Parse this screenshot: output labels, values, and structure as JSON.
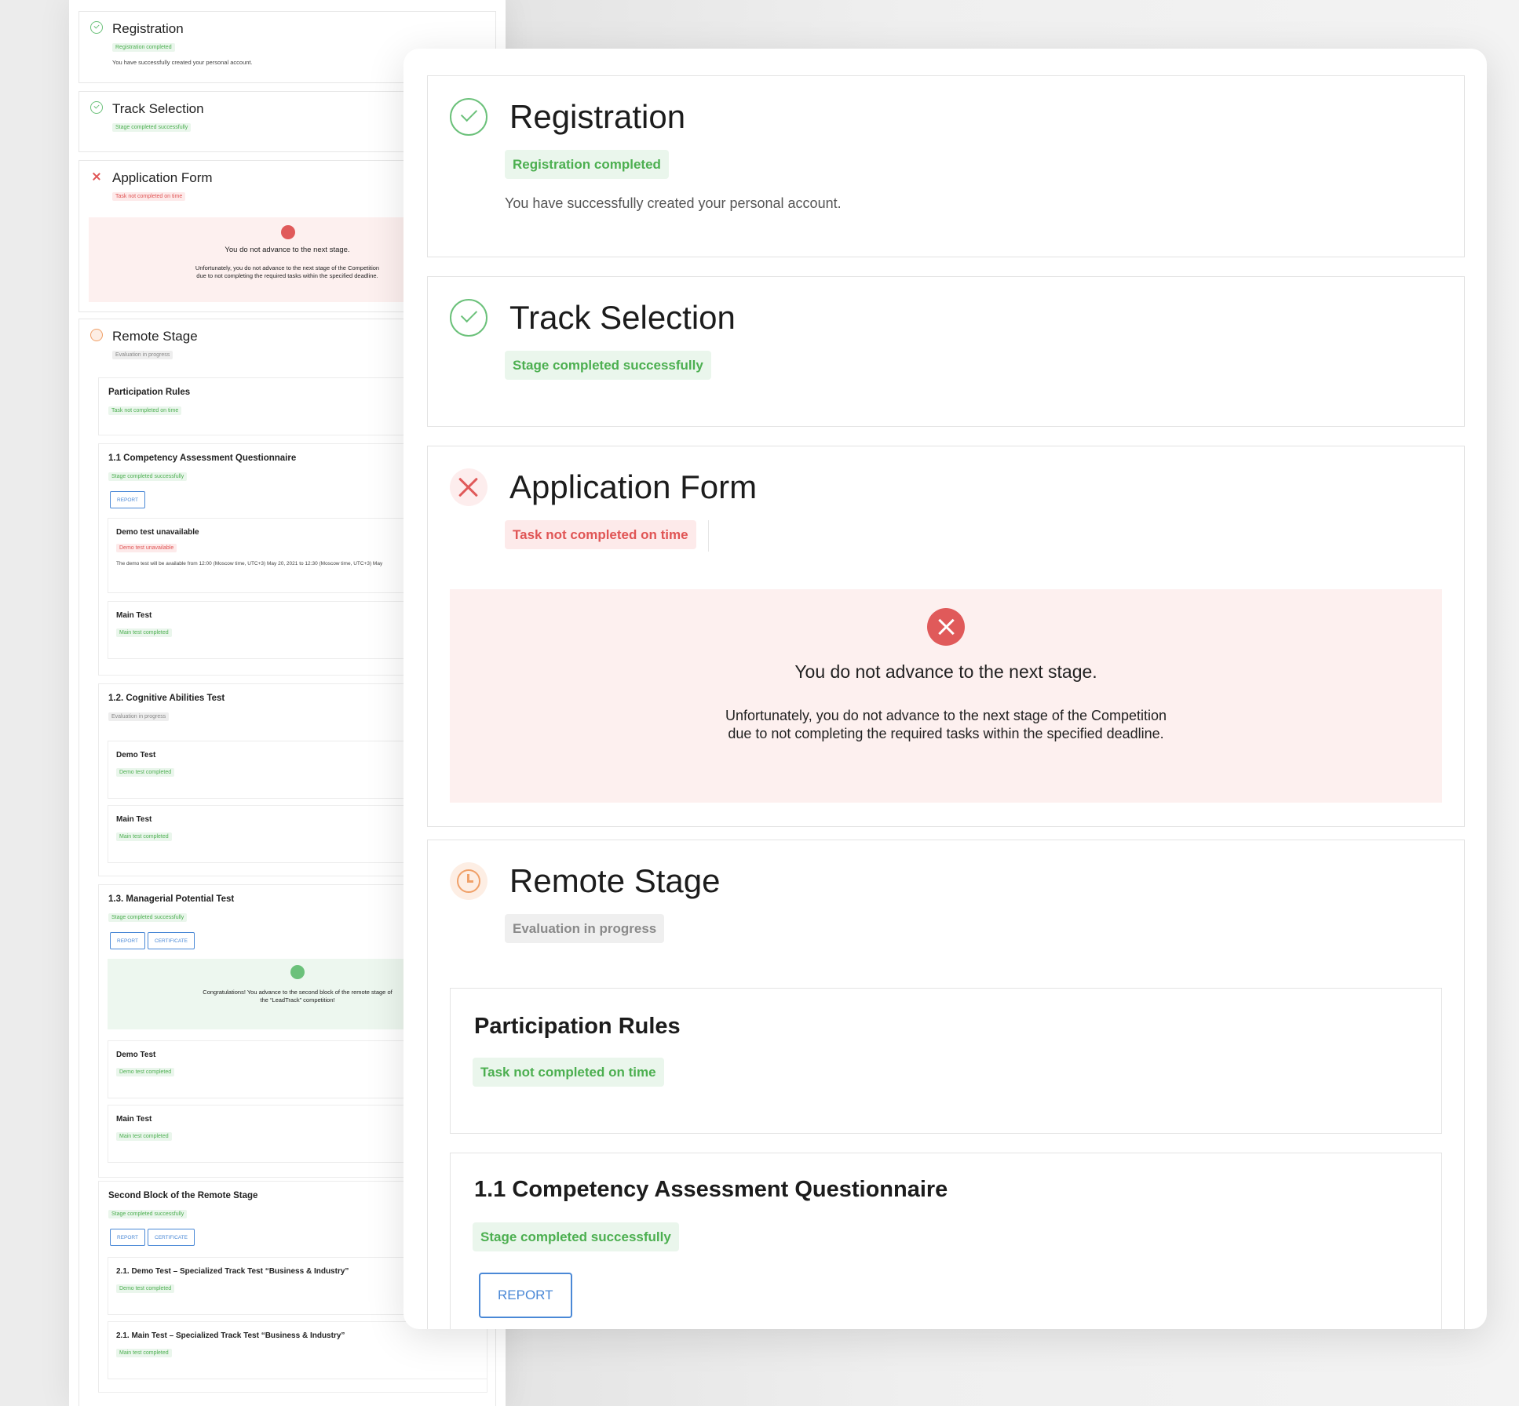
{
  "stages": {
    "registration": {
      "title": "Registration",
      "status": "Registration completed",
      "description": "You have successfully created your personal account."
    },
    "track_selection": {
      "title": "Track Selection",
      "status": "Stage completed successfully"
    },
    "application_form": {
      "title": "Application Form",
      "status": "Task not completed on time",
      "alert_title": "You do not advance to the next stage.",
      "alert_line1": "Unfortunately, you do not advance to the next stage of the Competition",
      "alert_line2": "due to not completing the required tasks within the specified deadline."
    },
    "remote_stage": {
      "title": "Remote Stage",
      "status": "Evaluation in progress",
      "participation_rules": {
        "title": "Participation Rules",
        "status": "Task not completed on time"
      },
      "competency": {
        "title": "1.1 Competency Assessment Questionnaire",
        "status": "Stage completed successfully",
        "report_label": "REPORT"
      }
    }
  },
  "mini": {
    "registration": {
      "title": "Registration",
      "status": "Registration completed",
      "description": "You have successfully created your personal account."
    },
    "track_selection": {
      "title": "Track Selection",
      "status": "Stage completed successfully"
    },
    "application_form": {
      "title": "Application Form",
      "status": "Task not completed on time",
      "alert_title": "You do not advance to the next stage.",
      "alert_line1": "Unfortunately, you do not advance to the next stage of the Competition",
      "alert_line2": "due to not completing the required tasks within the specified deadline."
    },
    "remote_stage": {
      "title": "Remote Stage",
      "status": "Evaluation in progress"
    },
    "participation_rules": {
      "title": "Participation Rules",
      "status": "Task not completed on time"
    },
    "competency": {
      "title": "1.1 Competency Assessment Questionnaire",
      "status": "Stage completed successfully",
      "report": "REPORT"
    },
    "demo_unavailable": {
      "title": "Demo test unavailable",
      "status": "Demo test unavailable",
      "description": "The demo test will be available from 12:00 (Moscow time, UTC+3) May 20, 2021 to 12:30 (Moscow time, UTC+3) May"
    },
    "main_test_1": {
      "title": "Main Test",
      "status": "Main test completed"
    },
    "cognitive": {
      "title": "1.2. Cognitive Abilities Test",
      "status": "Evaluation in progress"
    },
    "demo_test_2": {
      "title": "Demo Test",
      "status": "Demo test completed"
    },
    "main_test_2": {
      "title": "Main Test",
      "status": "Main test completed"
    },
    "managerial": {
      "title": "1.3. Managerial Potential Test",
      "status": "Stage completed successfully",
      "report": "REPORT",
      "certificate": "CERTIFICATE",
      "congrats_line1": "Congratulations! You advance to the second block of the remote stage of",
      "congrats_line2": "the “LeadTrack” competition!"
    },
    "demo_test_3": {
      "title": "Demo Test",
      "status": "Demo test completed"
    },
    "main_test_3": {
      "title": "Main Test",
      "status": "Main test completed"
    },
    "second_block": {
      "title": "Second Block of the Remote Stage",
      "status": "Stage completed successfully",
      "report": "REPORT",
      "certificate": "CERTIFICATE"
    },
    "spec_demo": {
      "title": "2.1. Demo Test – Specialized Track Test “Business & Industry”",
      "status": "Demo test completed"
    },
    "spec_main": {
      "title": "2.1. Main Test – Specialized Track Test “Business & Industry”",
      "status": "Main test completed"
    }
  }
}
